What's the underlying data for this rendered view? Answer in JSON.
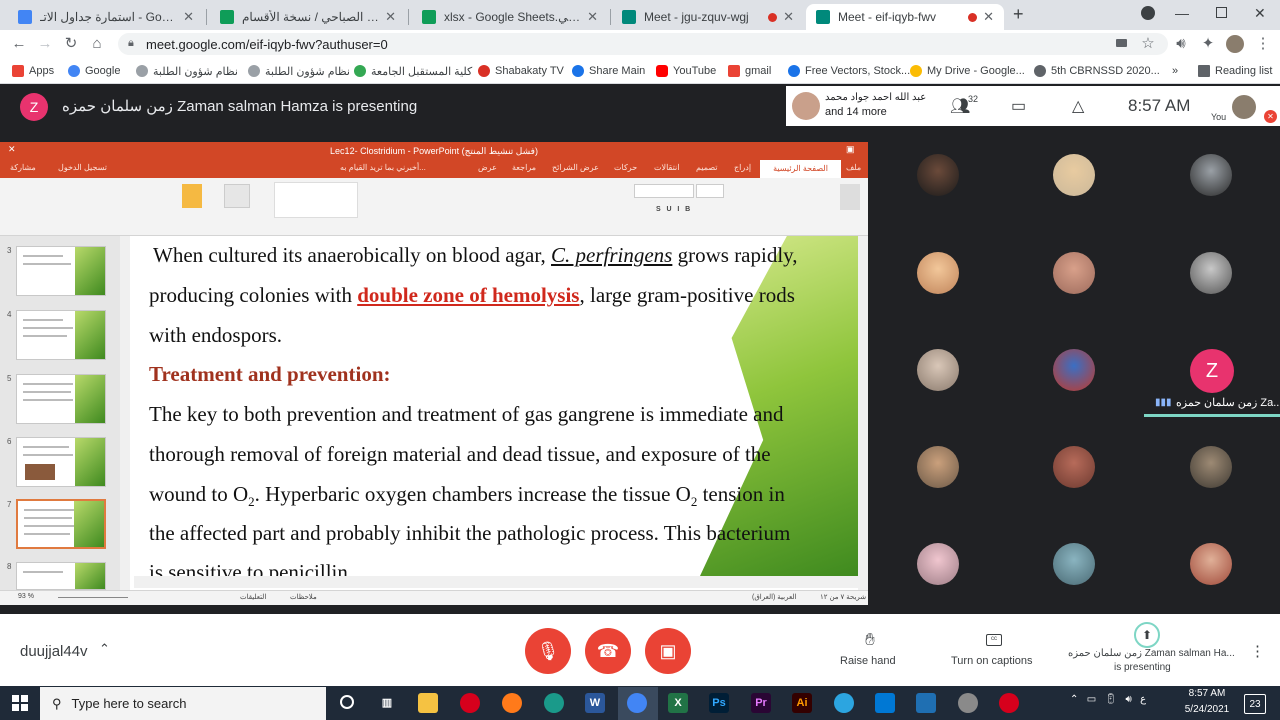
{
  "browser": {
    "tabs": [
      {
        "title": "استمارة جداول الاتـ - Google Drive",
        "fav_color": "#4285f4"
      },
      {
        "title": "الصباحي / نسخة الأقسام Sheets",
        "fav_color": "#0f9d58"
      },
      {
        "title": "xlsx - Google Sheets.الصباحي",
        "fav_color": "#0f9d58"
      },
      {
        "title": "Meet - jgu-zquv-wgj",
        "fav_color": "#00897b"
      },
      {
        "title": "Meet - eif-iqyb-fwv",
        "fav_color": "#00897b"
      }
    ],
    "url": "meet.google.com/eif-iqyb-fwv?authuser=0",
    "bookmarks": [
      {
        "label": "Apps",
        "color": "#ea4335"
      },
      {
        "label": "Google",
        "color": "#4285f4"
      },
      {
        "label": "نظام شؤون الطلبة",
        "color": "#9aa0a6"
      },
      {
        "label": "نظام شؤون الطلبة",
        "color": "#9aa0a6"
      },
      {
        "label": "كلية المستقبل الجامعة",
        "color": "#34a853"
      },
      {
        "label": "Shabakaty TV",
        "color": "#d93025"
      },
      {
        "label": "Share Main",
        "color": "#1a73e8"
      },
      {
        "label": "YouTube",
        "color": "#ff0000"
      },
      {
        "label": "gmail",
        "color": "#ea4335"
      },
      {
        "label": "Free Vectors, Stock...",
        "color": "#1a73e8"
      },
      {
        "label": "My Drive - Google...",
        "color": "#fbbc04"
      },
      {
        "label": "5th CBRNSSD 2020...",
        "color": "#5f6368"
      }
    ],
    "bookmarks_more": "»",
    "reading_list": "Reading list"
  },
  "meet": {
    "presenter_initial": "Z",
    "presenter_title": "زمن سلمان حمزه Zaman salman Hamza is presenting",
    "speaker_name": "عبد الله احمد جواد محمد",
    "speaker_more": "and 14 more",
    "participant_count": "32",
    "time": "8:57 AM",
    "you_label": "You",
    "meeting_code": "duujjal44v",
    "raise_hand": "Raise hand",
    "captions": "Turn on captions",
    "presenting_name": "زمن سلمان حمزه Zaman salman Ha...",
    "presenting_label": "is presenting",
    "tile_label": "زمن سلمان حمزه Za...",
    "tile_initial": "Z",
    "accent_red": "#ea4335",
    "accent_pink": "#e8336e"
  },
  "ppt": {
    "window_title": "Lec12- Clostridium - PowerPoint (فشل تنشيط المنتج)",
    "ribbon_tabs": [
      "ملف",
      "الصفحة الرئيسية",
      "إدراج",
      "تصميم",
      "انتقالات",
      "حركات",
      "عرض الشرائح",
      "مراجعة",
      "عرض",
      "أخبرني بما تريد القيام به..."
    ],
    "sign_in": "تسجيل الدخول",
    "share": "مشاركة",
    "thumb_numbers": [
      "3",
      "4",
      "5",
      "6",
      "7",
      "8"
    ],
    "slide": {
      "line1_a": "When cultured its anaerobically on blood agar, ",
      "line1_b": "C. perfringens",
      "line1_c": " grows rapidly,",
      "line2_a": "producing colonies with ",
      "line2_b": "double zone of hemolysis",
      "line2_c": ", large gram-positive rods",
      "line3": "with endospors.",
      "heading": "Treatment and prevention:",
      "p1": "The key to both prevention and treatment of gas gangrene is immediate and",
      "p2": "thorough removal of foreign material and dead tissue, and exposure of the",
      "p3_a": "wound to O",
      "p3_b": ". Hyperbaric oxygen chambers increase the tissue O",
      "p3_c": " tension in",
      "sub2": "2",
      "p4": "the affected part and probably inhibit the pathologic process. This bacterium",
      "p5": "is sensitive to penicillin."
    },
    "status_slide": "شريحة ٧ من ١٢",
    "status_lang": "العربية (العراق)",
    "status_notes": "ملاحظات",
    "status_comments": "التعليقات",
    "zoom": "93 %"
  },
  "taskbar": {
    "search_placeholder": "Type here to search",
    "time": "8:57 AM",
    "date": "5/24/2021",
    "notifications": "23",
    "lang": "ع"
  }
}
